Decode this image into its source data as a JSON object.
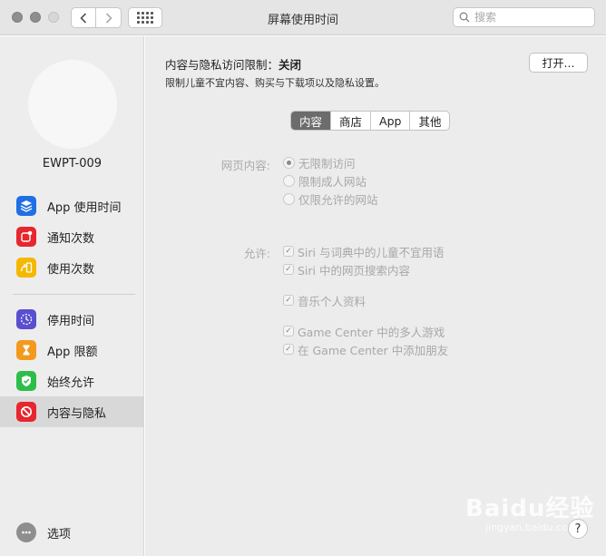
{
  "window": {
    "title": "屏幕使用时间"
  },
  "search": {
    "placeholder": "搜索"
  },
  "sidebar": {
    "username": "EWPT-009",
    "items": [
      {
        "label": "App 使用时间",
        "icon": "layers-icon",
        "color": "#1f6fe5"
      },
      {
        "label": "通知次数",
        "icon": "notification-icon",
        "color": "#e8262d"
      },
      {
        "label": "使用次数",
        "icon": "pickup-icon",
        "color": "#f5b800"
      },
      {
        "label": "停用时间",
        "icon": "downtime-icon",
        "color": "#5a4fcf"
      },
      {
        "label": "App 限额",
        "icon": "hourglass-icon",
        "color": "#f39a1e"
      },
      {
        "label": "始终允许",
        "icon": "checkmark-shield-icon",
        "color": "#2fbd4a"
      },
      {
        "label": "内容与隐私",
        "icon": "no-entry-icon",
        "color": "#e8262d"
      }
    ],
    "options_label": "选项"
  },
  "main": {
    "restriction_label": "内容与隐私访问限制：",
    "restriction_state": "关闭",
    "description": "限制儿童不宜内容、购买与下载项以及隐私设置。",
    "open_button": "打开…",
    "tabs": [
      {
        "label": "内容",
        "active": true
      },
      {
        "label": "商店",
        "active": false
      },
      {
        "label": "App",
        "active": false
      },
      {
        "label": "其他",
        "active": false
      }
    ],
    "web_content_label": "网页内容:",
    "web_options": [
      {
        "label": "无限制访问",
        "selected": true
      },
      {
        "label": "限制成人网站",
        "selected": false
      },
      {
        "label": "仅限允许的网站",
        "selected": false
      }
    ],
    "allow_label": "允许:",
    "allow_options": [
      {
        "label": "Siri 与词典中的儿童不宜用语",
        "checked": true
      },
      {
        "label": "Siri 中的网页搜索内容",
        "checked": true
      },
      {
        "label": "音乐个人资料",
        "checked": true
      },
      {
        "label": "Game Center 中的多人游戏",
        "checked": true
      },
      {
        "label": "在 Game Center 中添加朋友",
        "checked": true
      }
    ],
    "help": "?"
  },
  "watermark": {
    "brand": "Baidu经验",
    "url": "jingyan.baidu.com"
  }
}
